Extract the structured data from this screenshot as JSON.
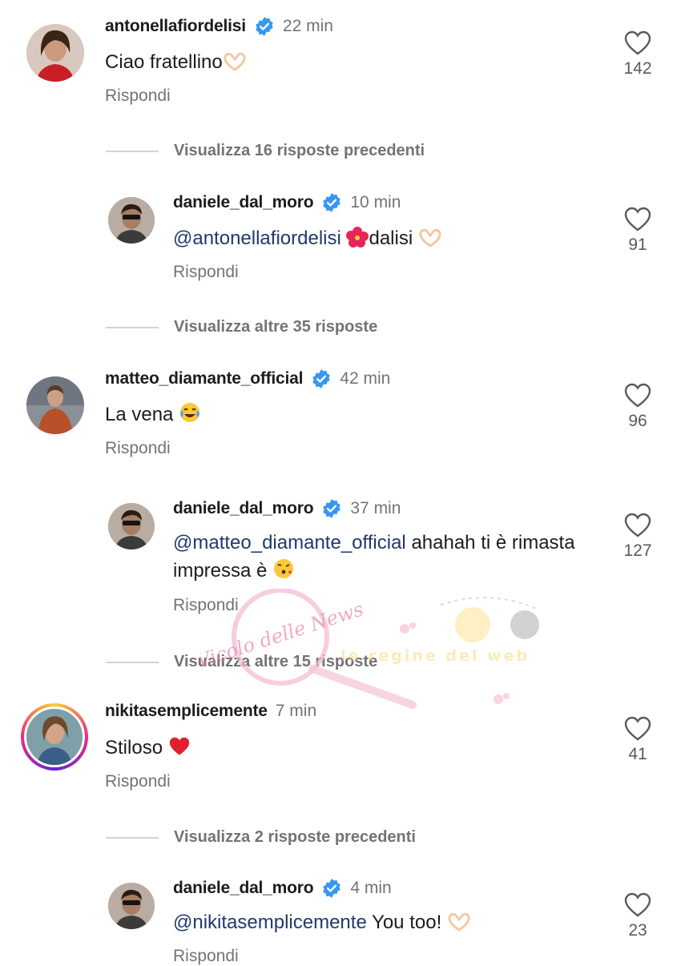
{
  "comments": [
    {
      "username": "antonellafiordelisi",
      "time": "22 min",
      "text": "Ciao fratellino",
      "reply_label": "Rispondi",
      "likes": "142"
    },
    {
      "view_more": "Visualizza 16 risposte precedenti"
    },
    {
      "username": "daniele_dal_moro",
      "time": "10 min",
      "mention": "@antonellafiordelisi",
      "text": "dalisi",
      "reply_label": "Rispondi",
      "likes": "91"
    },
    {
      "view_more": "Visualizza altre 35 risposte"
    },
    {
      "username": "matteo_diamante_official",
      "time": "42 min",
      "text": "La vena",
      "reply_label": "Rispondi",
      "likes": "96"
    },
    {
      "username": "daniele_dal_moro",
      "time": "37 min",
      "mention": "@matteo_diamante_official",
      "text": "ahahah ti è rimasta impressa è",
      "reply_label": "Rispondi",
      "likes": "127"
    },
    {
      "view_more": "Visualizza altre 15 risposte"
    },
    {
      "username": "nikitasemplicemente",
      "time": "7 min",
      "text": "Stiloso",
      "reply_label": "Rispondi",
      "likes": "41"
    },
    {
      "view_more": "Visualizza 2 risposte precedenti"
    },
    {
      "username": "daniele_dal_moro",
      "time": "4 min",
      "mention": "@nikitasemplicemente",
      "text": "You too!",
      "reply_label": "Rispondi",
      "likes": "23"
    }
  ],
  "watermark": {
    "brand": "Vicolo delle News",
    "tagline": "le regine del web"
  },
  "icons": {
    "verified": "verified-badge-icon",
    "like": "heart-outline-icon"
  },
  "colors": {
    "verified": "#3897f0",
    "mention": "#1e3a6e",
    "secondary_text": "#737373"
  }
}
